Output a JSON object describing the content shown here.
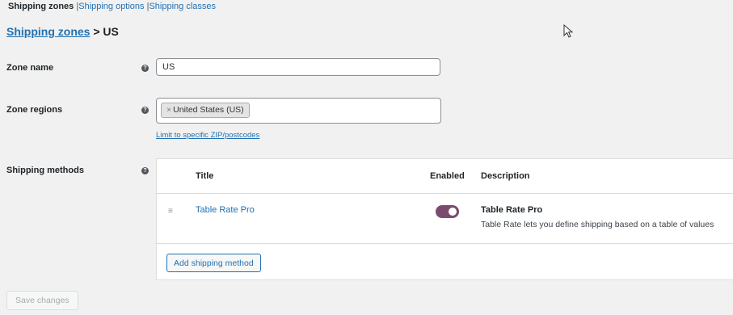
{
  "subnav": {
    "items": [
      {
        "label": "Shipping zones",
        "current": true
      },
      {
        "label": "Shipping options",
        "current": false
      },
      {
        "label": "Shipping classes",
        "current": false
      }
    ],
    "separator": "|"
  },
  "breadcrumb": {
    "link": "Shipping zones",
    "rest": " > US"
  },
  "zone_name": {
    "label": "Zone name",
    "value": "US"
  },
  "zone_regions": {
    "label": "Zone regions",
    "chip_remove": "×",
    "chip": "United States (US)",
    "limit_link": "Limit to specific ZIP/postcodes"
  },
  "help_icon_glyph": "?",
  "shipping_methods": {
    "label": "Shipping methods",
    "columns": {
      "title": "Title",
      "enabled": "Enabled",
      "description": "Description"
    },
    "rows": [
      {
        "drag_handle": "≡",
        "title": "Table Rate Pro",
        "enabled": true,
        "desc_title": "Table Rate Pro",
        "desc_text": "Table Rate lets you define shipping based on a table of values"
      }
    ],
    "add_button": "Add shipping method"
  },
  "save_button": "Save changes",
  "colors": {
    "link": "#2271b1",
    "toggle_on": "#7b4b6f",
    "background": "#f1f1f1"
  }
}
